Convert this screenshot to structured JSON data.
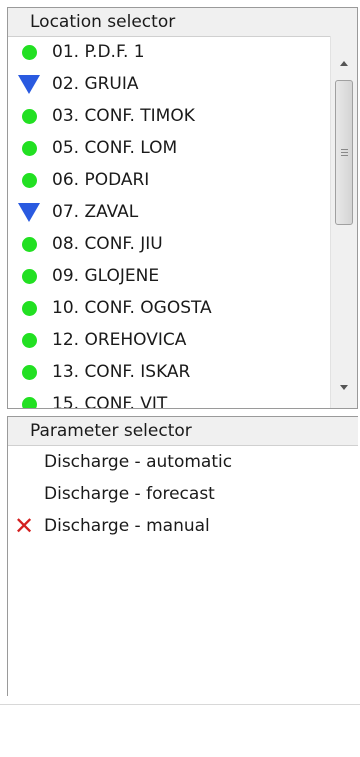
{
  "location_selector": {
    "title": "Location selector",
    "items": [
      {
        "label": "01. P.D.F. 1",
        "icon": "green-dot-icon"
      },
      {
        "label": "02. GRUIA",
        "icon": "blue-triangle-icon"
      },
      {
        "label": "03. CONF. TIMOK",
        "icon": "green-dot-icon"
      },
      {
        "label": "05. CONF. LOM",
        "icon": "green-dot-icon"
      },
      {
        "label": "06. PODARI",
        "icon": "green-dot-icon"
      },
      {
        "label": "07. ZAVAL",
        "icon": "blue-triangle-icon"
      },
      {
        "label": "08. CONF. JIU",
        "icon": "green-dot-icon"
      },
      {
        "label": "09. GLOJENE",
        "icon": "green-dot-icon"
      },
      {
        "label": "10. CONF. OGOSTA",
        "icon": "green-dot-icon"
      },
      {
        "label": "12. OREHOVICA",
        "icon": "green-dot-icon"
      },
      {
        "label": "13. CONF. ISKAR",
        "icon": "green-dot-icon"
      },
      {
        "label": "15. CONF. VIT",
        "icon": "green-dot-icon"
      }
    ]
  },
  "parameter_selector": {
    "title": "Parameter selector",
    "items": [
      {
        "label": "Discharge - automatic",
        "icon": ""
      },
      {
        "label": "Discharge - forecast",
        "icon": ""
      },
      {
        "label": "Discharge - manual",
        "icon": "red-x-icon"
      }
    ]
  },
  "colors": {
    "green_dot": "#22e022",
    "blue_triangle": "#2a5ae0",
    "red_x": "#d42020"
  }
}
